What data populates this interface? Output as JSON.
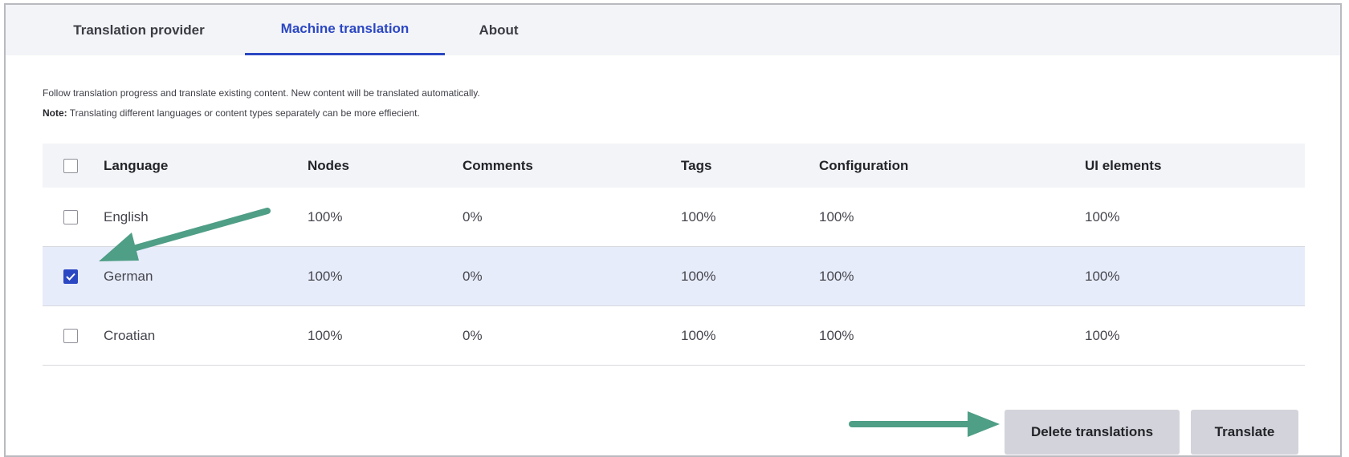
{
  "tabs": [
    {
      "label": "Translation provider",
      "active": false
    },
    {
      "label": "Machine translation",
      "active": true
    },
    {
      "label": "About",
      "active": false
    }
  ],
  "description": {
    "line1": "Follow translation progress and translate existing content. New content will be translated automatically.",
    "note_label": "Note:",
    "note_text": " Translating different languages or content types separately can be more effiecient."
  },
  "table": {
    "headers": [
      "Language",
      "Nodes",
      "Comments",
      "Tags",
      "Configuration",
      "UI elements"
    ],
    "rows": [
      {
        "checked": false,
        "cells": [
          "English",
          "100%",
          "0%",
          "100%",
          "100%",
          "100%"
        ]
      },
      {
        "checked": true,
        "cells": [
          "German",
          "100%",
          "0%",
          "100%",
          "100%",
          "100%"
        ]
      },
      {
        "checked": false,
        "cells": [
          "Croatian",
          "100%",
          "0%",
          "100%",
          "100%",
          "100%"
        ]
      }
    ]
  },
  "buttons": {
    "delete_label": "Delete translations",
    "translate_label": "Translate"
  },
  "colors": {
    "accent": "#2b47c2",
    "annotation_arrow": "#4f9e86"
  }
}
